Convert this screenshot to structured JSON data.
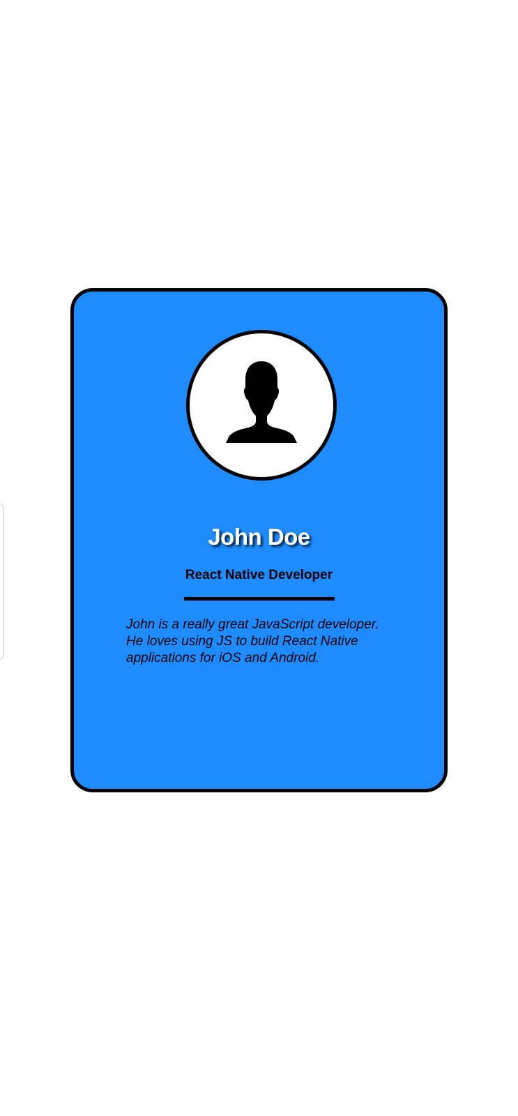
{
  "card": {
    "avatar_icon": "person-silhouette-icon",
    "name": "John Doe",
    "role": "React Native Developer",
    "bio": "John is a really great JavaScript developer. He loves using JS to build React Native applications for iOS and Android."
  },
  "colors": {
    "card_background": "#1e8cff",
    "card_border": "#000000",
    "avatar_background": "#ffffff",
    "name_text": "#ffffff",
    "body_text": "#000000"
  }
}
